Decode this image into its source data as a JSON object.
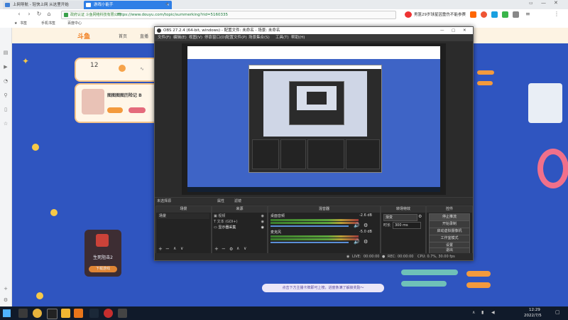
{
  "browser": {
    "tabs": [
      {
        "label": "上网导航 - 轻快上网 从这里开始"
      },
      {
        "label": "游戏小能手"
      }
    ],
    "url": "https://www.douyu.com/topic/summerking?rid=5160335",
    "site_security_label": "政府认证 斗鱼网络科技有限公司",
    "search_hint": "男篮29岁球星因重伤不能参赛",
    "bookmarks": [
      "书签",
      "手机书签",
      "百度中心"
    ]
  },
  "webpage": {
    "site_nav": [
      "斗鱼",
      "首页",
      "直播"
    ],
    "stat_number": "12",
    "streamer_title": "图图图图历险记 B",
    "left_card_title": "生死阻击2",
    "left_card_button": "下载游戏",
    "bottom_notice": "点击下方主播卡牌即可上榜，进度条满了解锁奖励～"
  },
  "obs": {
    "title": "OBS 27.2.4 (64-bit, windows) - 配置文件: 未命名 - 场景: 未命名",
    "menu": [
      "文件(F)",
      "编辑(E)",
      "视图(V)",
      "停靠窗口(D)",
      "配置文件(P)",
      "场景集合(S)",
      "工具(T)",
      "帮助(H)"
    ],
    "context_bar": {
      "no_source": "未选择源",
      "properties": "属性",
      "filters": "滤镜"
    },
    "docks": {
      "scenes": {
        "title": "场景",
        "items": [
          "场景"
        ]
      },
      "sources": {
        "title": "来源",
        "items": [
          "视频",
          "文本 (GDI+)",
          "显示器采集"
        ]
      },
      "mixer": {
        "title": "混音器",
        "channels": [
          {
            "name": "桌面音频",
            "db": "-2.6 dB"
          },
          {
            "name": "麦克风",
            "db": "-5.0 dB"
          }
        ]
      },
      "transitions": {
        "title": "转场特效",
        "type": "渐变",
        "duration_label": "时长",
        "duration": "300 ms"
      },
      "controls": {
        "title": "控件",
        "buttons": [
          "停止推流",
          "开始录制",
          "启动虚拟摄像机",
          "工作室模式",
          "设置",
          "退出"
        ]
      }
    },
    "status": {
      "live_label": "LIVE:",
      "live_time": "00:00:00",
      "rec_label": "REC:",
      "rec_time": "00:00:00",
      "cpu": "CPU: 0.7%, 30.00 fps"
    }
  },
  "taskbar": {
    "time": "12:29",
    "date": "2022/7/5"
  }
}
